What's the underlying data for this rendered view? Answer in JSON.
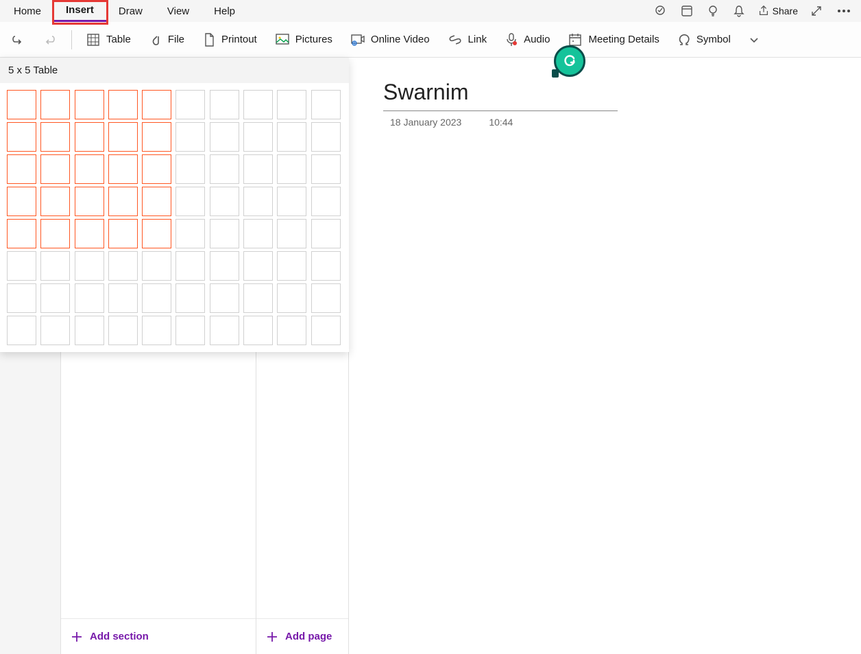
{
  "menu": {
    "items": [
      "Home",
      "Insert",
      "Draw",
      "View",
      "Help"
    ],
    "share_label": "Share"
  },
  "ribbon": {
    "table": "Table",
    "file": "File",
    "printout": "Printout",
    "pictures": "Pictures",
    "online_video": "Online Video",
    "link": "Link",
    "audio": "Audio",
    "meeting_details": "Meeting Details",
    "symbol": "Symbol"
  },
  "table_picker": {
    "label": "5 x 5 Table",
    "rows": 8,
    "cols": 10,
    "sel_rows": 5,
    "sel_cols": 5
  },
  "sidebar": {
    "add_section": "Add section",
    "add_page": "Add page"
  },
  "page": {
    "title": "Swarnim",
    "date": "18 January 2023",
    "time": "10:44"
  }
}
